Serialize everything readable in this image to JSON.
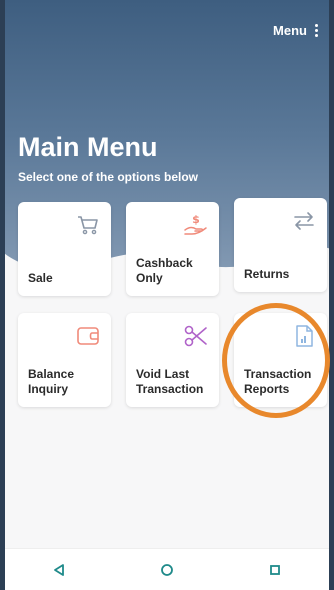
{
  "header": {
    "menu_label": "Menu",
    "title": "Main Menu",
    "subtitle": "Select one of the options below"
  },
  "tiles": [
    {
      "label": "Sale",
      "icon": "cart-icon"
    },
    {
      "label": "Cashback\nOnly",
      "icon": "cash-hand-icon"
    },
    {
      "label": "Returns",
      "icon": "swap-arrows-icon"
    },
    {
      "label": "Balance\nInquiry",
      "icon": "wallet-icon"
    },
    {
      "label": "Void Last\nTransaction",
      "icon": "scissors-icon"
    },
    {
      "label": "Transaction\nReports",
      "icon": "report-document-icon"
    }
  ],
  "nav": {
    "back": "back-triangle-icon",
    "home": "home-circle-icon",
    "recents": "recents-square-icon"
  },
  "colors": {
    "header_dark": "#3e5e80",
    "icon_gray": "#8a96a6",
    "icon_coral": "#f08a7a",
    "icon_purple": "#b063c9",
    "icon_lightblue": "#8fb6e0",
    "highlight_orange": "#e8882c",
    "nav_teal": "#1f8a8a"
  }
}
